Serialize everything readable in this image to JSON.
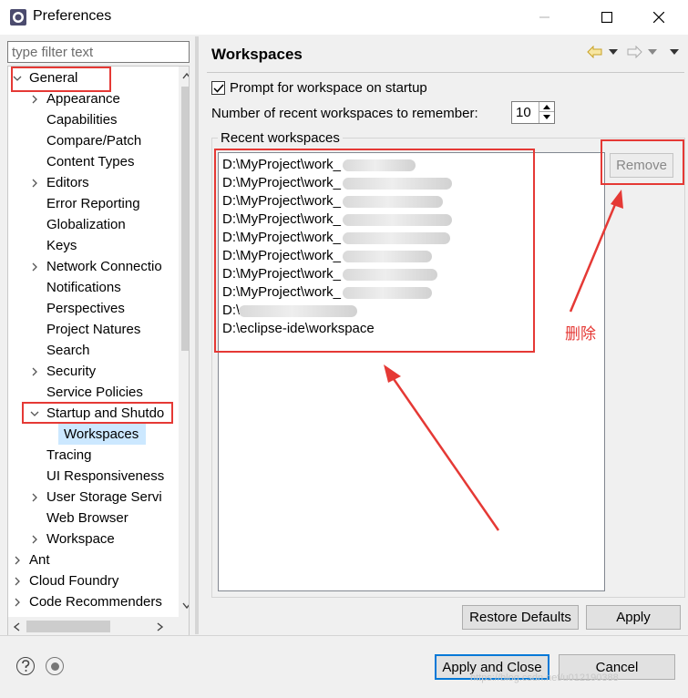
{
  "window": {
    "title": "Preferences",
    "minimize_glyph": "—",
    "maximize_glyph": "☐",
    "close_glyph": "✕"
  },
  "filter": {
    "placeholder": "type filter text"
  },
  "tree": [
    {
      "label": "General",
      "level": 0,
      "chevron": "expanded"
    },
    {
      "label": "Appearance",
      "level": 1,
      "chevron": "collapsed"
    },
    {
      "label": "Capabilities",
      "level": 1,
      "chevron": "none"
    },
    {
      "label": "Compare/Patch",
      "level": 1,
      "chevron": "none"
    },
    {
      "label": "Content Types",
      "level": 1,
      "chevron": "none"
    },
    {
      "label": "Editors",
      "level": 1,
      "chevron": "collapsed"
    },
    {
      "label": "Error Reporting",
      "level": 1,
      "chevron": "none"
    },
    {
      "label": "Globalization",
      "level": 1,
      "chevron": "none"
    },
    {
      "label": "Keys",
      "level": 1,
      "chevron": "none"
    },
    {
      "label": "Network Connectio",
      "level": 1,
      "chevron": "collapsed"
    },
    {
      "label": "Notifications",
      "level": 1,
      "chevron": "none"
    },
    {
      "label": "Perspectives",
      "level": 1,
      "chevron": "none"
    },
    {
      "label": "Project Natures",
      "level": 1,
      "chevron": "none"
    },
    {
      "label": "Search",
      "level": 1,
      "chevron": "none"
    },
    {
      "label": "Security",
      "level": 1,
      "chevron": "collapsed"
    },
    {
      "label": "Service Policies",
      "level": 1,
      "chevron": "none"
    },
    {
      "label": "Startup and Shutdo",
      "level": 1,
      "chevron": "expanded"
    },
    {
      "label": "Workspaces",
      "level": 2,
      "chevron": "none",
      "selected": true
    },
    {
      "label": "Tracing",
      "level": 1,
      "chevron": "none"
    },
    {
      "label": "UI Responsiveness",
      "level": 1,
      "chevron": "none"
    },
    {
      "label": "User Storage Servi",
      "level": 1,
      "chevron": "collapsed"
    },
    {
      "label": "Web Browser",
      "level": 1,
      "chevron": "none"
    },
    {
      "label": "Workspace",
      "level": 1,
      "chevron": "collapsed"
    },
    {
      "label": "Ant",
      "level": 0,
      "chevron": "collapsed"
    },
    {
      "label": "Cloud Foundry",
      "level": 0,
      "chevron": "collapsed"
    },
    {
      "label": "Code Recommenders",
      "level": 0,
      "chevron": "collapsed"
    }
  ],
  "page": {
    "title": "Workspaces",
    "prompt_label": "Prompt for workspace on startup",
    "prompt_checked": true,
    "recent_count_label": "Number of recent workspaces to remember:",
    "recent_count_value": "10",
    "group_label": "Recent workspaces",
    "workspaces": [
      "D:\\MyProject\\work_",
      "D:\\MyProject\\work_",
      "D:\\MyProject\\work_",
      "D:\\MyProject\\work_",
      "D:\\MyProject\\work_",
      "D:\\MyProject\\work_",
      "D:\\MyProject\\work_",
      "D:\\MyProject\\work_",
      "D:\\",
      "D:\\eclipse-ide\\workspace"
    ],
    "remove_label": "Remove"
  },
  "buttons": {
    "restore_defaults": "Restore Defaults",
    "apply": "Apply",
    "apply_and_close": "Apply and Close",
    "cancel": "Cancel"
  },
  "annotation": {
    "text": "删除",
    "color": "#e53935"
  },
  "watermark": "https://blog.csdn.net/u012190388",
  "colors": {
    "selection": "#cce8ff",
    "default_button_border": "#0078d7",
    "annotation": "#e53935"
  }
}
